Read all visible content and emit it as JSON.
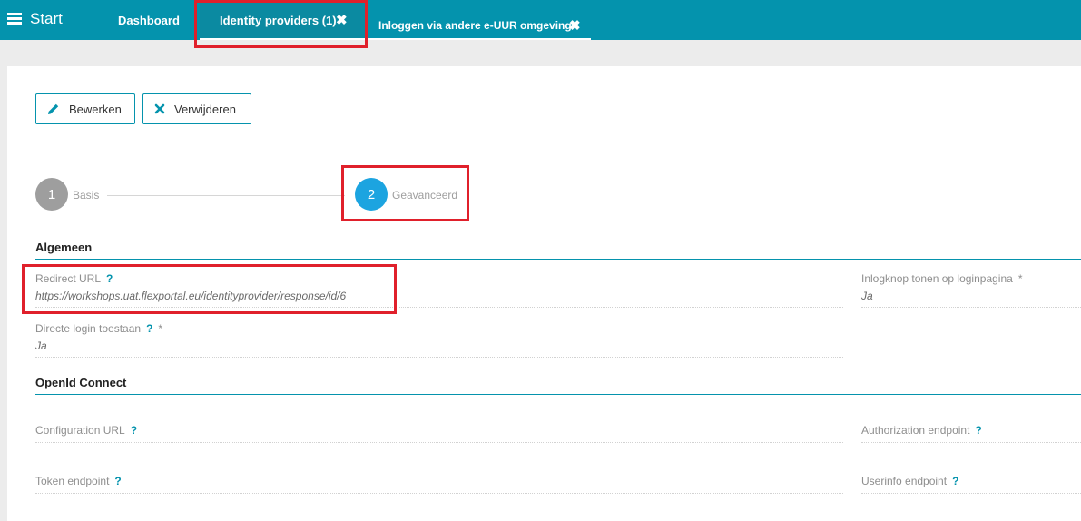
{
  "topbar": {
    "start_label": "Start",
    "tabs": [
      {
        "label": "Dashboard"
      },
      {
        "label": "Identity providers (1)",
        "close": "✖"
      },
      {
        "label": "Inloggen via andere e-UUR omgeving",
        "close": "✖"
      }
    ]
  },
  "toolbar": {
    "edit_label": "Bewerken",
    "delete_label": "Verwijderen"
  },
  "steps": [
    {
      "number": "1",
      "label": "Basis"
    },
    {
      "number": "2",
      "label": "Geavanceerd"
    }
  ],
  "sections": {
    "algemeen": {
      "title": "Algemeen",
      "redirect_url": {
        "label": "Redirect URL",
        "help": "?",
        "value": "https://workshops.uat.flexportal.eu/identityprovider/response/id/6"
      },
      "inlogknop": {
        "label": "Inlogknop tonen op loginpagina",
        "required": "*",
        "value": "Ja"
      },
      "directe_login": {
        "label": "Directe login toestaan",
        "help": "?",
        "required": "*",
        "value": "Ja"
      }
    },
    "openid": {
      "title": "OpenId Connect",
      "configuration_url": {
        "label": "Configuration URL",
        "help": "?"
      },
      "authorization_endpoint": {
        "label": "Authorization endpoint",
        "help": "?"
      },
      "token_endpoint": {
        "label": "Token endpoint",
        "help": "?"
      },
      "userinfo_endpoint": {
        "label": "Userinfo endpoint",
        "help": "?"
      }
    }
  },
  "colors": {
    "topbar": "#0493ad",
    "highlight": "#e0202b",
    "step_active": "#1ca4e0",
    "step_inactive": "#9e9e9e"
  }
}
